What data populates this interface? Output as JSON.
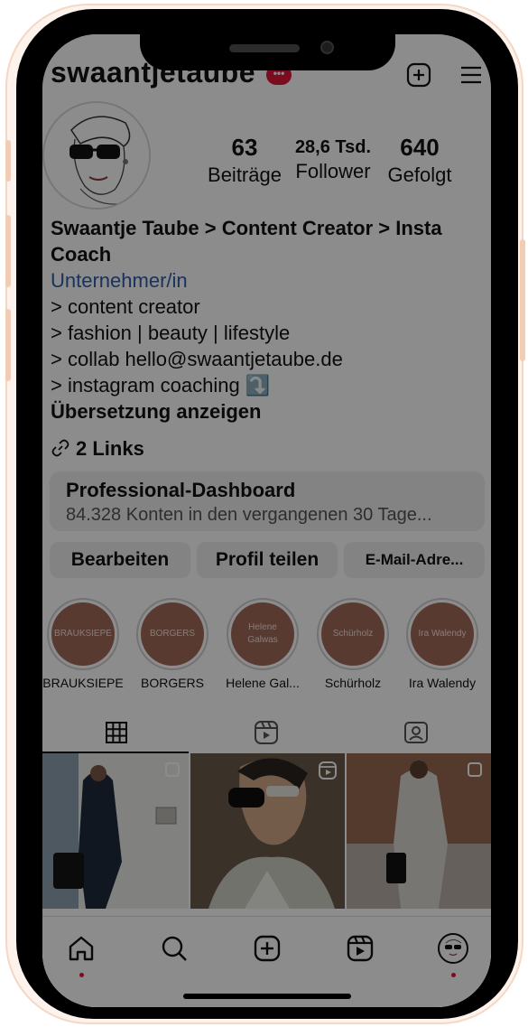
{
  "header": {
    "username": "swaantjetaube",
    "live_badge": "•••"
  },
  "stats": [
    {
      "value": "63",
      "label": "Beiträge"
    },
    {
      "value": "28,6 Tsd.",
      "label": "Follower"
    },
    {
      "value": "640",
      "label": "Gefolgt"
    }
  ],
  "bio": {
    "name_line1": "Swaantje Taube > Content Creator > Insta",
    "name_line2": "Coach",
    "category": "Unternehmer/in",
    "lines": [
      "> content creator",
      "> fashion | beauty | lifestyle",
      "> collab hello@swaantjetaube.de",
      "> instagram coaching ⤵️"
    ],
    "translate": "Übersetzung anzeigen",
    "links": "2 Links"
  },
  "dashboard": {
    "title": "Professional-Dashboard",
    "subtitle": "84.328 Konten in den vergangenen 30 Tage..."
  },
  "buttons": {
    "edit": "Bearbeiten",
    "share": "Profil teilen",
    "email": "E-Mail-Adre..."
  },
  "highlights": [
    {
      "inner": "BRAUKSIEPE",
      "label": "BRAUKSIEPE"
    },
    {
      "inner": "BORGERS",
      "label": "BORGERS"
    },
    {
      "inner": "Helene Galwas",
      "label": "Helene Gal..."
    },
    {
      "inner": "Schürholz",
      "label": "Schürholz"
    },
    {
      "inner": "Ira Walendy",
      "label": "Ira Walendy"
    }
  ],
  "colors": {
    "accent": "#e0163b",
    "link": "#2b5dab",
    "highlight_bg": "#a06a5a"
  },
  "icons": {
    "tab_grid": "grid-icon",
    "tab_reels": "reels-icon",
    "tab_tagged": "tagged-icon",
    "nav": [
      "home-icon",
      "search-icon",
      "create-icon",
      "reels-icon",
      "profile-avatar"
    ]
  }
}
